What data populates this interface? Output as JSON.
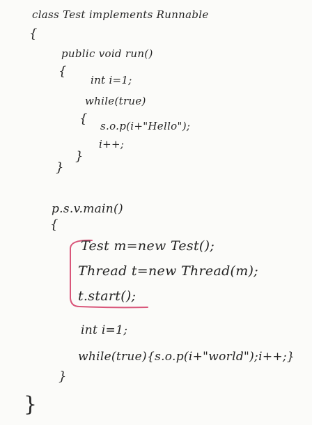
{
  "whiteboard": {
    "class_decl": "class Test implements Runnable",
    "class_open": "{",
    "run_sig": "public void run()",
    "run_open": "{",
    "run_var": "int i=1;",
    "run_while": "while(true)",
    "run_while_open": "{",
    "run_print": "s.o.p(i+\"Hello\");",
    "run_incr": "i++;",
    "run_while_close": "}",
    "run_close": "}",
    "main_sig": "p.s.v.main()",
    "main_open": "{",
    "main_new_test": "Test m=new Test();",
    "main_new_thread": "Thread t=new Thread(m);",
    "main_start": "t.start();",
    "main_var": "int i=1;",
    "main_loop": "while(true){s.o.p(i+\"world\");i++;}",
    "main_close": "}",
    "class_close": "}"
  },
  "colors": {
    "ink": "#232323",
    "highlight": "#d9567a",
    "board": "#fbfbf9"
  }
}
